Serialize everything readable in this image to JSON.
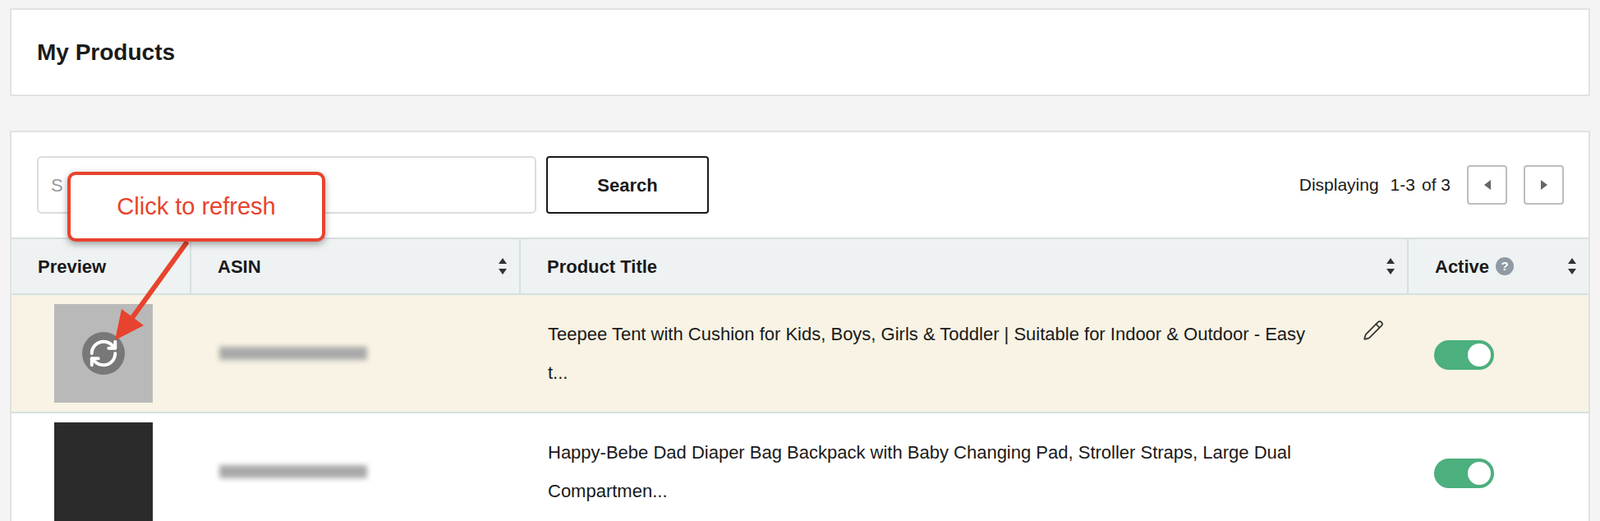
{
  "page": {
    "title": "My Products"
  },
  "search": {
    "placeholder": "S",
    "button": "Search"
  },
  "pagination": {
    "label": "Displaying",
    "range": "1-3",
    "total": "of 3",
    "prev_disabled": false,
    "next_disabled": false
  },
  "table": {
    "columns": [
      {
        "label": "Preview",
        "sortable": false,
        "help": ""
      },
      {
        "label": "ASIN",
        "sortable": true,
        "help": ""
      },
      {
        "label": "Product Title",
        "sortable": true,
        "help": ""
      },
      {
        "label": "Active",
        "sortable": true,
        "help": "?"
      }
    ],
    "rows": [
      {
        "asin_blurred": true,
        "title": "Teepee Tent with Cushion for Kids, Boys, Girls & Toddler | Suitable for Indoor & Outdoor - Easy t...",
        "active": true,
        "selected": true,
        "refresh_shown": true,
        "editable": true,
        "image_color": "#b9b9b9"
      },
      {
        "asin_blurred": true,
        "title": "Happy-Bebe Dad Diaper Bag Backpack with Baby Changing Pad, Stroller Straps, Large Dual Compartmen...",
        "active": true,
        "selected": false,
        "refresh_shown": false,
        "editable": false,
        "image_color": "#2b2b2b"
      }
    ]
  },
  "callout": {
    "text": "Click to refresh"
  }
}
